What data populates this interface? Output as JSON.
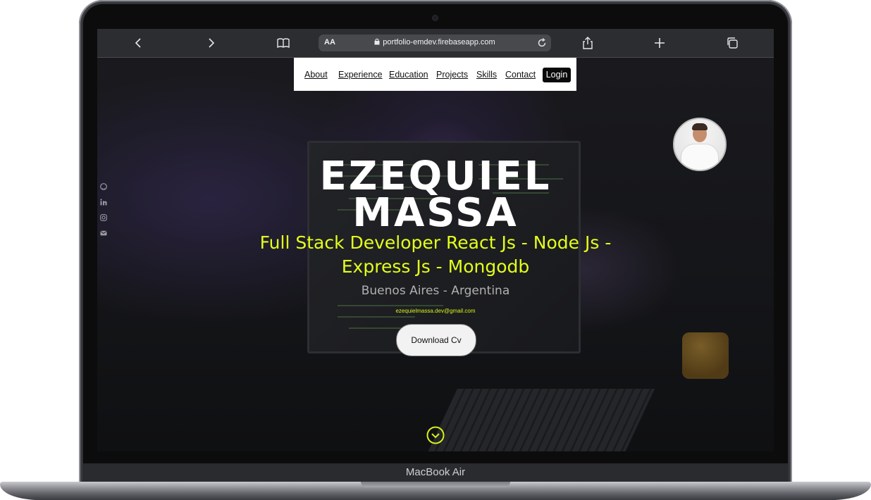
{
  "device": {
    "brand": "MacBook Air"
  },
  "browser": {
    "address_prefix": "AA",
    "url": "portfolio-emdev.firebaseapp.com",
    "icons": [
      "back-icon",
      "forward-icon",
      "book-icon",
      "lock-icon",
      "reload-icon",
      "share-icon",
      "new-tab-icon",
      "tabs-icon"
    ]
  },
  "nav": {
    "items": [
      "About",
      "Experience",
      "Education",
      "Projects",
      "Skills",
      "Contact"
    ],
    "login": "Login"
  },
  "social": [
    "github-icon",
    "linkedin-icon",
    "instagram-icon",
    "mail-icon"
  ],
  "hero": {
    "first_name": "EZEQUIEL",
    "last_name": "MASSA",
    "role": "Full Stack Developer React Js - Node Js - Express Js - Mongodb",
    "location": "Buenos Aires - Argentina",
    "email": "ezequielmassa.dev@gmail.com",
    "cv_button": "Download Cv"
  },
  "colors": {
    "accent": "#e4ff1a",
    "nav_bg": "#ffffff",
    "login_bg": "#0a0a0a"
  }
}
